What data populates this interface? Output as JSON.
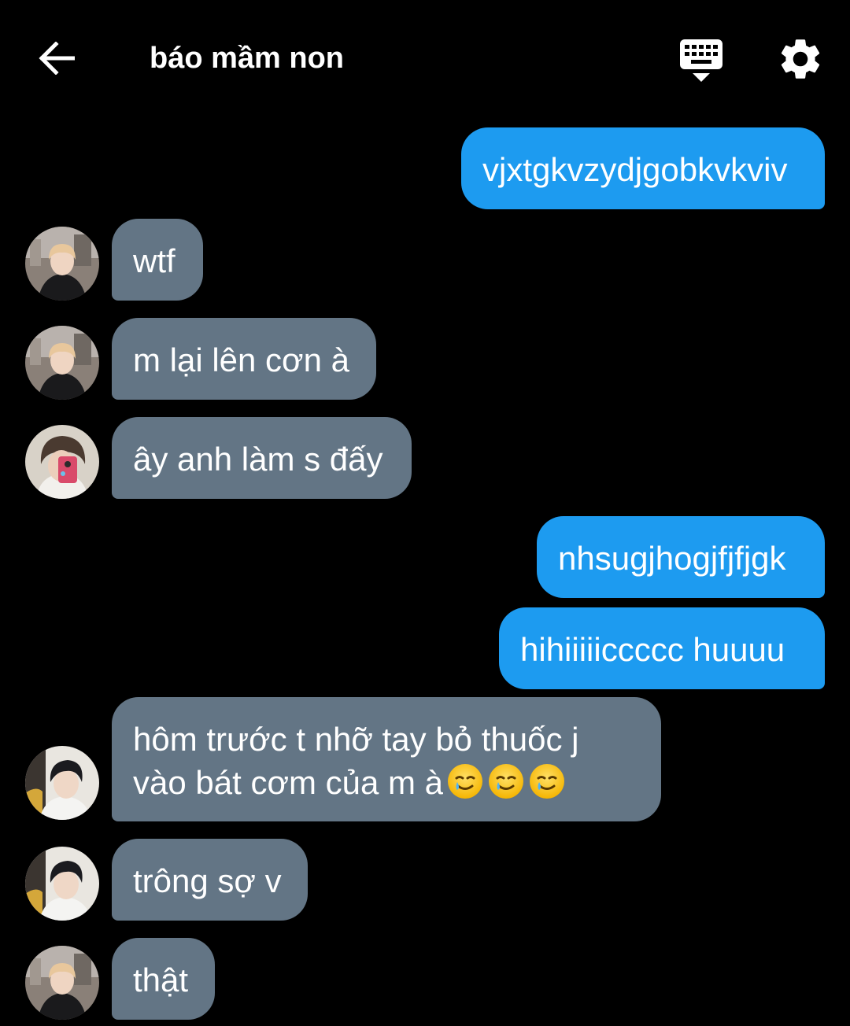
{
  "header": {
    "title": "báo mầm non",
    "back_icon": "arrow-left-icon",
    "keyboard_icon": "keyboard-hide-icon",
    "settings_icon": "gear-icon"
  },
  "colors": {
    "background": "#000000",
    "sent_bubble": "#1d9bf0",
    "received_bubble": "#637585",
    "text": "#ffffff"
  },
  "messages": [
    {
      "direction": "sent",
      "text": "vjxtgkvzydjgobkvkviv"
    },
    {
      "direction": "received",
      "avatar": "avatar-light-hair",
      "text": "wtf"
    },
    {
      "direction": "received",
      "avatar": "avatar-light-hair",
      "text": "m lại lên cơn à"
    },
    {
      "direction": "received",
      "avatar": "avatar-mirror-selfie",
      "text": "ây anh làm s đấy"
    },
    {
      "direction": "sent",
      "text": "nhsugjhogjfjfjgk"
    },
    {
      "direction": "sent",
      "text": "hihiiiiiccccc huuuu"
    },
    {
      "direction": "received",
      "avatar": "avatar-dark-hair",
      "text_line1": "hôm trước t nhỡ tay bỏ thuốc j",
      "text_line2": "vào bát cơm của m à",
      "emoji": "smiling-face-with-tear-icon"
    },
    {
      "direction": "received",
      "avatar": "avatar-dark-hair",
      "text": "trông sợ v"
    },
    {
      "direction": "received",
      "avatar": "avatar-light-hair",
      "text": "thật"
    }
  ]
}
